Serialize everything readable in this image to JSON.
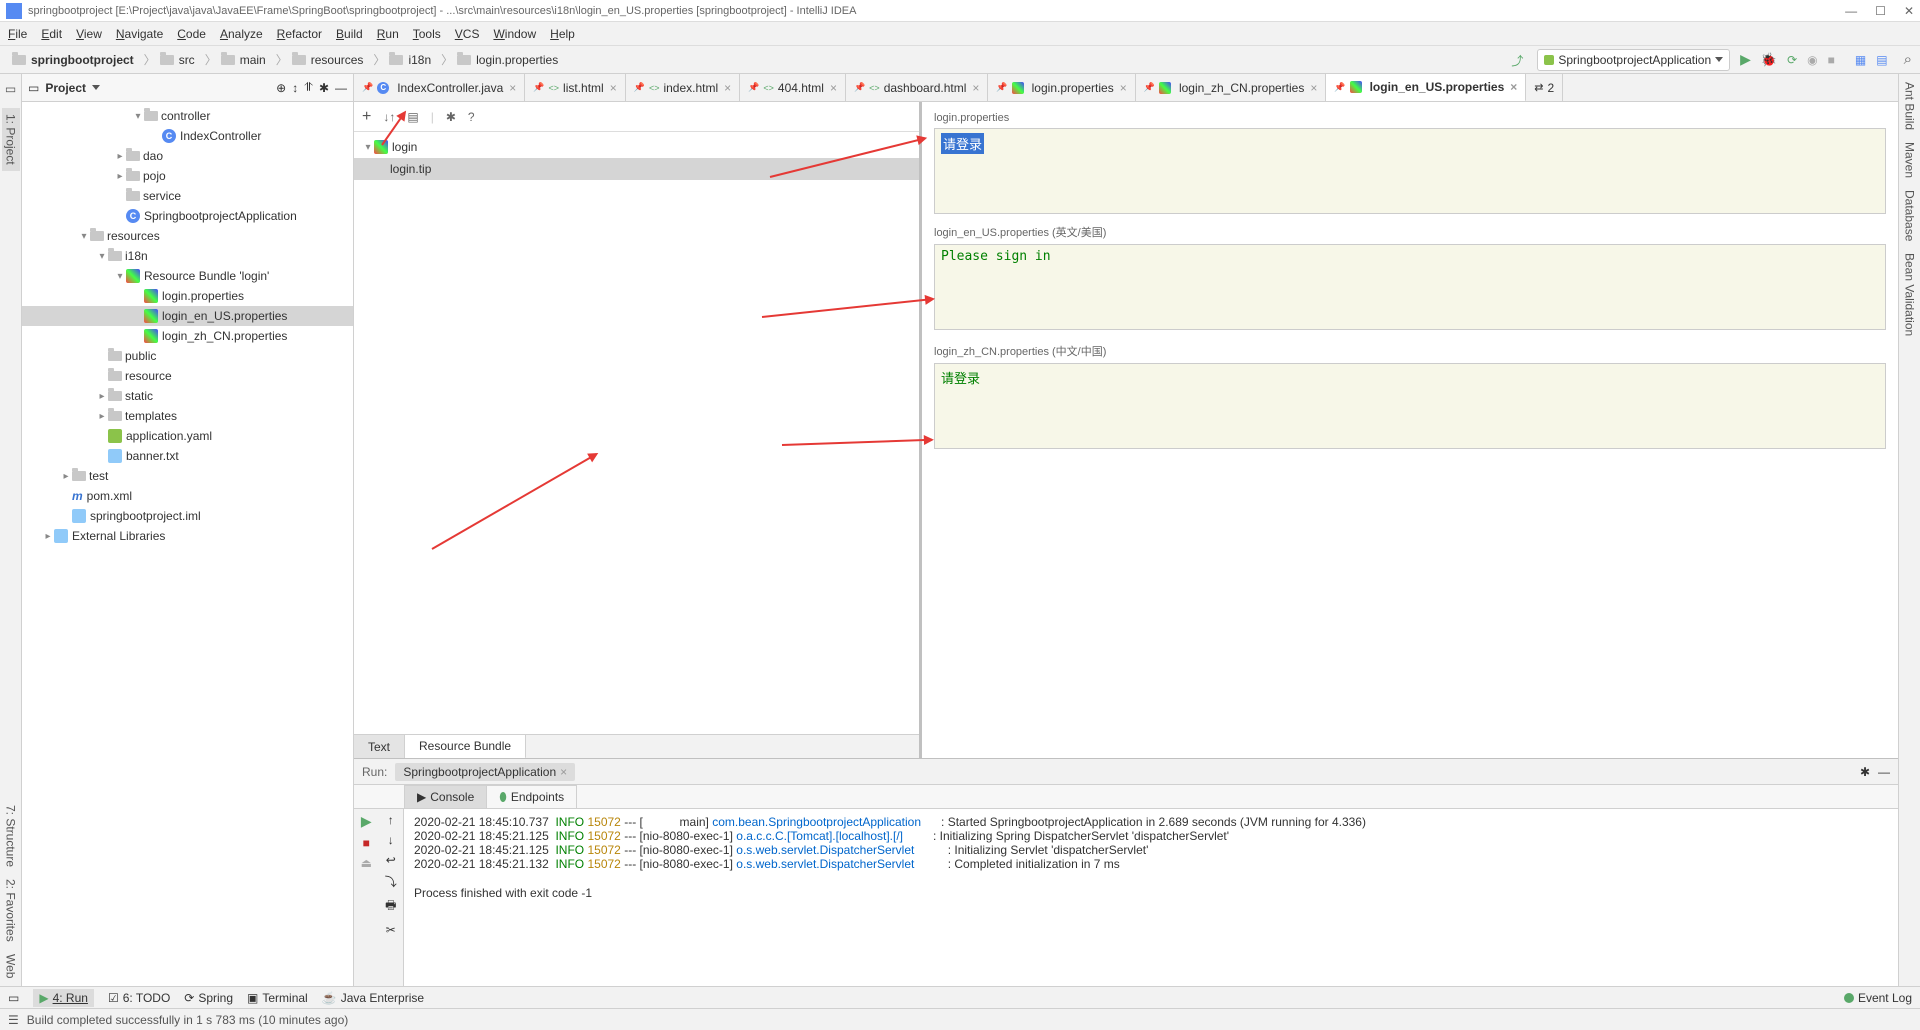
{
  "window": {
    "title": "springbootproject [E:\\Project\\java\\java\\JavaEE\\Frame\\SpringBoot\\springbootproject] - ...\\src\\main\\resources\\i18n\\login_en_US.properties [springbootproject] - IntelliJ IDEA"
  },
  "menu": {
    "items": [
      "File",
      "Edit",
      "View",
      "Navigate",
      "Code",
      "Analyze",
      "Refactor",
      "Build",
      "Run",
      "Tools",
      "VCS",
      "Window",
      "Help"
    ]
  },
  "breadcrumbs": [
    "springbootproject",
    "src",
    "main",
    "resources",
    "i18n",
    "login.properties"
  ],
  "runConfig": "SpringbootprojectApplication",
  "leftGutter": [
    "1: Project",
    "7: Structure",
    "2: Favorites",
    "Web"
  ],
  "rightGutter": [
    "Ant Build",
    "Maven",
    "Database",
    "Bean Validation"
  ],
  "projectPanel": {
    "title": "Project"
  },
  "tree": [
    {
      "indent": 5,
      "arrow": "▾",
      "icon": "folder",
      "label": "controller"
    },
    {
      "indent": 6,
      "arrow": "",
      "icon": "java",
      "label": "IndexController"
    },
    {
      "indent": 4,
      "arrow": "▸",
      "icon": "folder",
      "label": "dao"
    },
    {
      "indent": 4,
      "arrow": "▸",
      "icon": "folder",
      "label": "pojo"
    },
    {
      "indent": 4,
      "arrow": "",
      "icon": "folder",
      "label": "service"
    },
    {
      "indent": 4,
      "arrow": "",
      "icon": "java",
      "label": "SpringbootprojectApplication"
    },
    {
      "indent": 2,
      "arrow": "▾",
      "icon": "folder",
      "label": "resources"
    },
    {
      "indent": 3,
      "arrow": "▾",
      "icon": "folder",
      "label": "i18n"
    },
    {
      "indent": 4,
      "arrow": "▾",
      "icon": "bundle",
      "label": "Resource Bundle 'login'"
    },
    {
      "indent": 5,
      "arrow": "",
      "icon": "bundle",
      "label": "login.properties"
    },
    {
      "indent": 5,
      "arrow": "",
      "icon": "bundle",
      "label": "login_en_US.properties",
      "selected": true
    },
    {
      "indent": 5,
      "arrow": "",
      "icon": "bundle",
      "label": "login_zh_CN.properties"
    },
    {
      "indent": 3,
      "arrow": "",
      "icon": "folder",
      "label": "public"
    },
    {
      "indent": 3,
      "arrow": "",
      "icon": "folder",
      "label": "resource"
    },
    {
      "indent": 3,
      "arrow": "▸",
      "icon": "folder",
      "label": "static"
    },
    {
      "indent": 3,
      "arrow": "▸",
      "icon": "folder",
      "label": "templates"
    },
    {
      "indent": 3,
      "arrow": "",
      "icon": "yaml",
      "label": "application.yaml"
    },
    {
      "indent": 3,
      "arrow": "",
      "icon": "txt",
      "label": "banner.txt"
    },
    {
      "indent": 1,
      "arrow": "▸",
      "icon": "folder",
      "label": "test"
    },
    {
      "indent": 1,
      "arrow": "",
      "icon": "maven",
      "label": "pom.xml"
    },
    {
      "indent": 1,
      "arrow": "",
      "icon": "txt",
      "label": "springbootproject.iml"
    },
    {
      "indent": 0,
      "arrow": "▸",
      "icon": "lib",
      "label": "External Libraries"
    }
  ],
  "editorTabs": [
    {
      "label": "IndexController.java",
      "icon": "java"
    },
    {
      "label": "list.html",
      "icon": "html"
    },
    {
      "label": "index.html",
      "icon": "html"
    },
    {
      "label": "404.html",
      "icon": "html"
    },
    {
      "label": "dashboard.html",
      "icon": "html"
    },
    {
      "label": "login.properties",
      "icon": "bundle"
    },
    {
      "label": "login_zh_CN.properties",
      "icon": "bundle"
    },
    {
      "label": "login_en_US.properties",
      "icon": "bundle",
      "active": true
    }
  ],
  "bundleTree": {
    "root": "login",
    "child": "login.tip"
  },
  "props": {
    "p1": {
      "label": "login.properties",
      "value": "请登录"
    },
    "p2": {
      "label": "login_en_US.properties (英文/美国)",
      "value": "Please sign in"
    },
    "p3": {
      "label": "login_zh_CN.properties (中文/中国)",
      "value": "请登录"
    }
  },
  "bottomTabs": {
    "text": "Text",
    "bundle": "Resource Bundle"
  },
  "run": {
    "title": "Run:",
    "chip": "SpringbootprojectApplication",
    "subtabs": {
      "console": "Console",
      "endpoints": "Endpoints"
    },
    "log": [
      {
        "ts": "2020-02-21 18:45:10.737",
        "lvl": "INFO",
        "pid": "15072",
        "thread": "--- [           main]",
        "logger": "com.bean.SpringbootprojectApplication",
        "sep": ":",
        "msg": "Started SpringbootprojectApplication in 2.689 seconds (JVM running for 4.336)"
      },
      {
        "ts": "2020-02-21 18:45:21.125",
        "lvl": "INFO",
        "pid": "15072",
        "thread": "--- [nio-8080-exec-1]",
        "logger": "o.a.c.c.C.[Tomcat].[localhost].[/]",
        "sep": ":",
        "msg": "Initializing Spring DispatcherServlet 'dispatcherServlet'"
      },
      {
        "ts": "2020-02-21 18:45:21.125",
        "lvl": "INFO",
        "pid": "15072",
        "thread": "--- [nio-8080-exec-1]",
        "logger": "o.s.web.servlet.DispatcherServlet",
        "sep": ":",
        "msg": "Initializing Servlet 'dispatcherServlet'"
      },
      {
        "ts": "2020-02-21 18:45:21.132",
        "lvl": "INFO",
        "pid": "15072",
        "thread": "--- [nio-8080-exec-1]",
        "logger": "o.s.web.servlet.DispatcherServlet",
        "sep": ":",
        "msg": "Completed initialization in 7 ms"
      }
    ],
    "exit": "Process finished with exit code -1"
  },
  "toolStrip": {
    "run": "4: Run",
    "todo": "6: TODO",
    "spring": "Spring",
    "terminal": "Terminal",
    "javaee": "Java Enterprise",
    "eventlog": "Event Log"
  },
  "status": "Build completed successfully in 1 s 783 ms (10 minutes ago)"
}
